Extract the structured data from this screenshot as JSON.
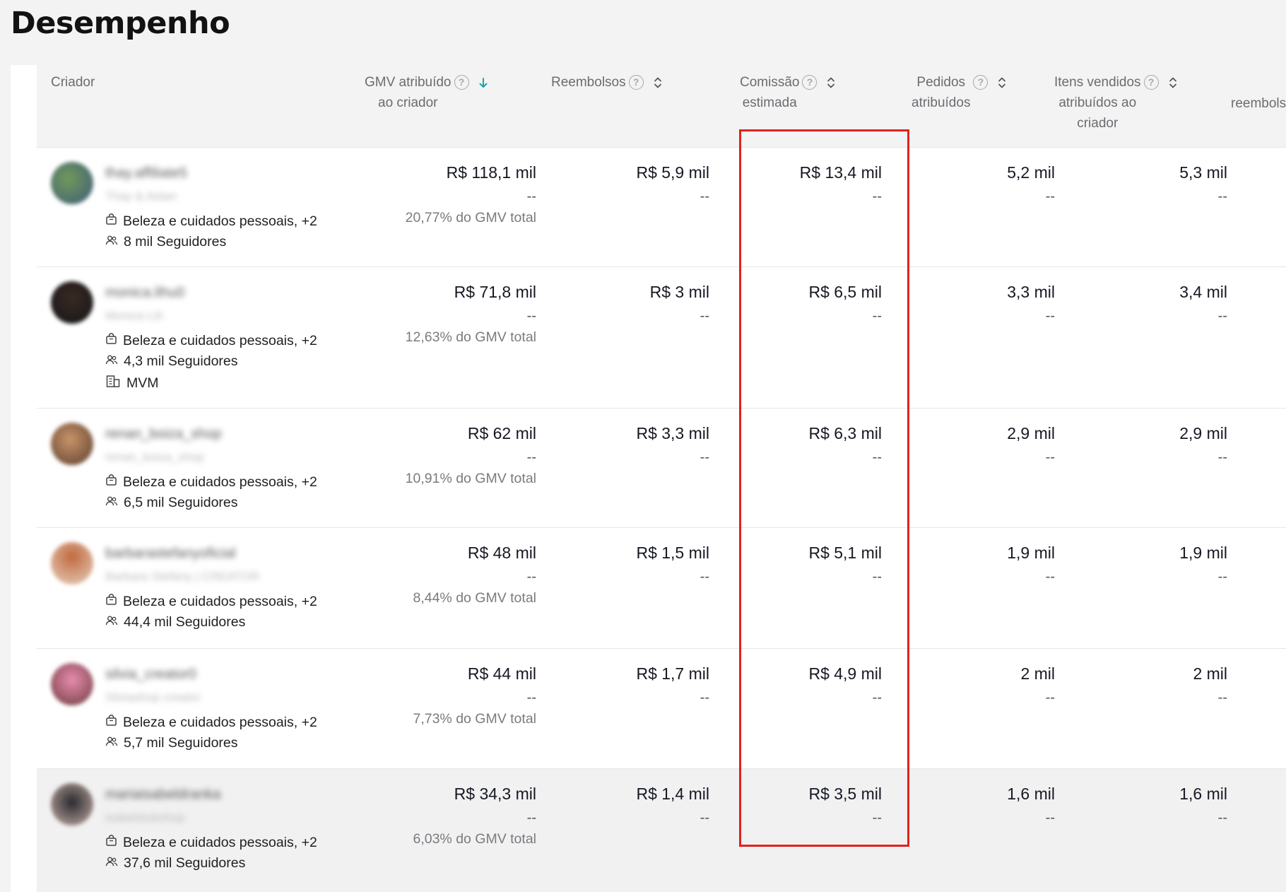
{
  "page": {
    "title": "Desempenho"
  },
  "columns": {
    "creator": "Criador",
    "gmv": [
      "GMV atribuído",
      "ao criador"
    ],
    "refunds": [
      "Reembolsos"
    ],
    "commission": [
      "Comissão",
      "estimada"
    ],
    "orders": [
      "Pedidos",
      "atribuídos"
    ],
    "items": [
      "Itens vendidos",
      "atribuídos ao",
      "criador"
    ],
    "extra": "reembols"
  },
  "icons": {
    "help": "question-circle-icon",
    "sort_active": "arrow-down-icon",
    "sort": "sort-updown-icon",
    "category": "shopping-bag-icon",
    "followers": "users-icon",
    "agency": "building-icon"
  },
  "colors": {
    "accent": "#1aa3a0",
    "highlight": "#e3211d"
  },
  "rows": [
    {
      "name": "thay.affiliate5",
      "display": "Thay & Aidan",
      "category": "Beleza e cuidados pessoais, +2",
      "followers": "8 mil Seguidores",
      "agency": "",
      "gmv": "R$ 118,1 mil",
      "gmv_sub": "--",
      "gmv_pct": "20,77% do GMV total",
      "refunds": "R$ 5,9 mil",
      "refunds_sub": "--",
      "commission": "R$ 13,4 mil",
      "commission_sub": "--",
      "orders": "5,2 mil",
      "orders_sub": "--",
      "items": "5,3 mil",
      "items_sub": "--"
    },
    {
      "name": "monica.lihu0",
      "display": "Monica Lih",
      "category": "Beleza e cuidados pessoais, +2",
      "followers": "4,3 mil Seguidores",
      "agency": "MVM",
      "gmv": "R$ 71,8 mil",
      "gmv_sub": "--",
      "gmv_pct": "12,63% do GMV total",
      "refunds": "R$ 3 mil",
      "refunds_sub": "--",
      "commission": "R$ 6,5 mil",
      "commission_sub": "--",
      "orders": "3,3 mil",
      "orders_sub": "--",
      "items": "3,4 mil",
      "items_sub": "--"
    },
    {
      "name": "renan_boiza_shop",
      "display": "renan_boiza_shop",
      "category": "Beleza e cuidados pessoais, +2",
      "followers": "6,5 mil Seguidores",
      "agency": "",
      "gmv": "R$ 62 mil",
      "gmv_sub": "--",
      "gmv_pct": "10,91% do GMV total",
      "refunds": "R$ 3,3 mil",
      "refunds_sub": "--",
      "commission": "R$ 6,3 mil",
      "commission_sub": "--",
      "orders": "2,9 mil",
      "orders_sub": "--",
      "items": "2,9 mil",
      "items_sub": "--"
    },
    {
      "name": "barbarastefanyoficial",
      "display": "Barbara Stefany | CREATOR",
      "category": "Beleza e cuidados pessoais, +2",
      "followers": "44,4 mil Seguidores",
      "agency": "",
      "gmv": "R$ 48 mil",
      "gmv_sub": "--",
      "gmv_pct": "8,44% do GMV total",
      "refunds": "R$ 1,5 mil",
      "refunds_sub": "--",
      "commission": "R$ 5,1 mil",
      "commission_sub": "--",
      "orders": "1,9 mil",
      "orders_sub": "--",
      "items": "1,9 mil",
      "items_sub": "--"
    },
    {
      "name": "silvia_creator0",
      "display": "Silviashop creator",
      "category": "Beleza e cuidados pessoais, +2",
      "followers": "5,7 mil Seguidores",
      "agency": "",
      "gmv": "R$ 44 mil",
      "gmv_sub": "--",
      "gmv_pct": "7,73% do GMV total",
      "refunds": "R$ 1,7 mil",
      "refunds_sub": "--",
      "commission": "R$ 4,9 mil",
      "commission_sub": "--",
      "orders": "2 mil",
      "orders_sub": "--",
      "items": "2 mil",
      "items_sub": "--"
    },
    {
      "name": "mariaisabeldranka",
      "display": "isabelstukshop",
      "category": "Beleza e cuidados pessoais, +2",
      "followers": "37,6 mil Seguidores",
      "agency": "",
      "gmv": "R$ 34,3 mil",
      "gmv_sub": "--",
      "gmv_pct": "6,03% do GMV total",
      "refunds": "R$ 1,4 mil",
      "refunds_sub": "--",
      "commission": "R$ 3,5 mil",
      "commission_sub": "--",
      "orders": "1,6 mil",
      "orders_sub": "--",
      "items": "1,6 mil",
      "items_sub": "--"
    }
  ]
}
